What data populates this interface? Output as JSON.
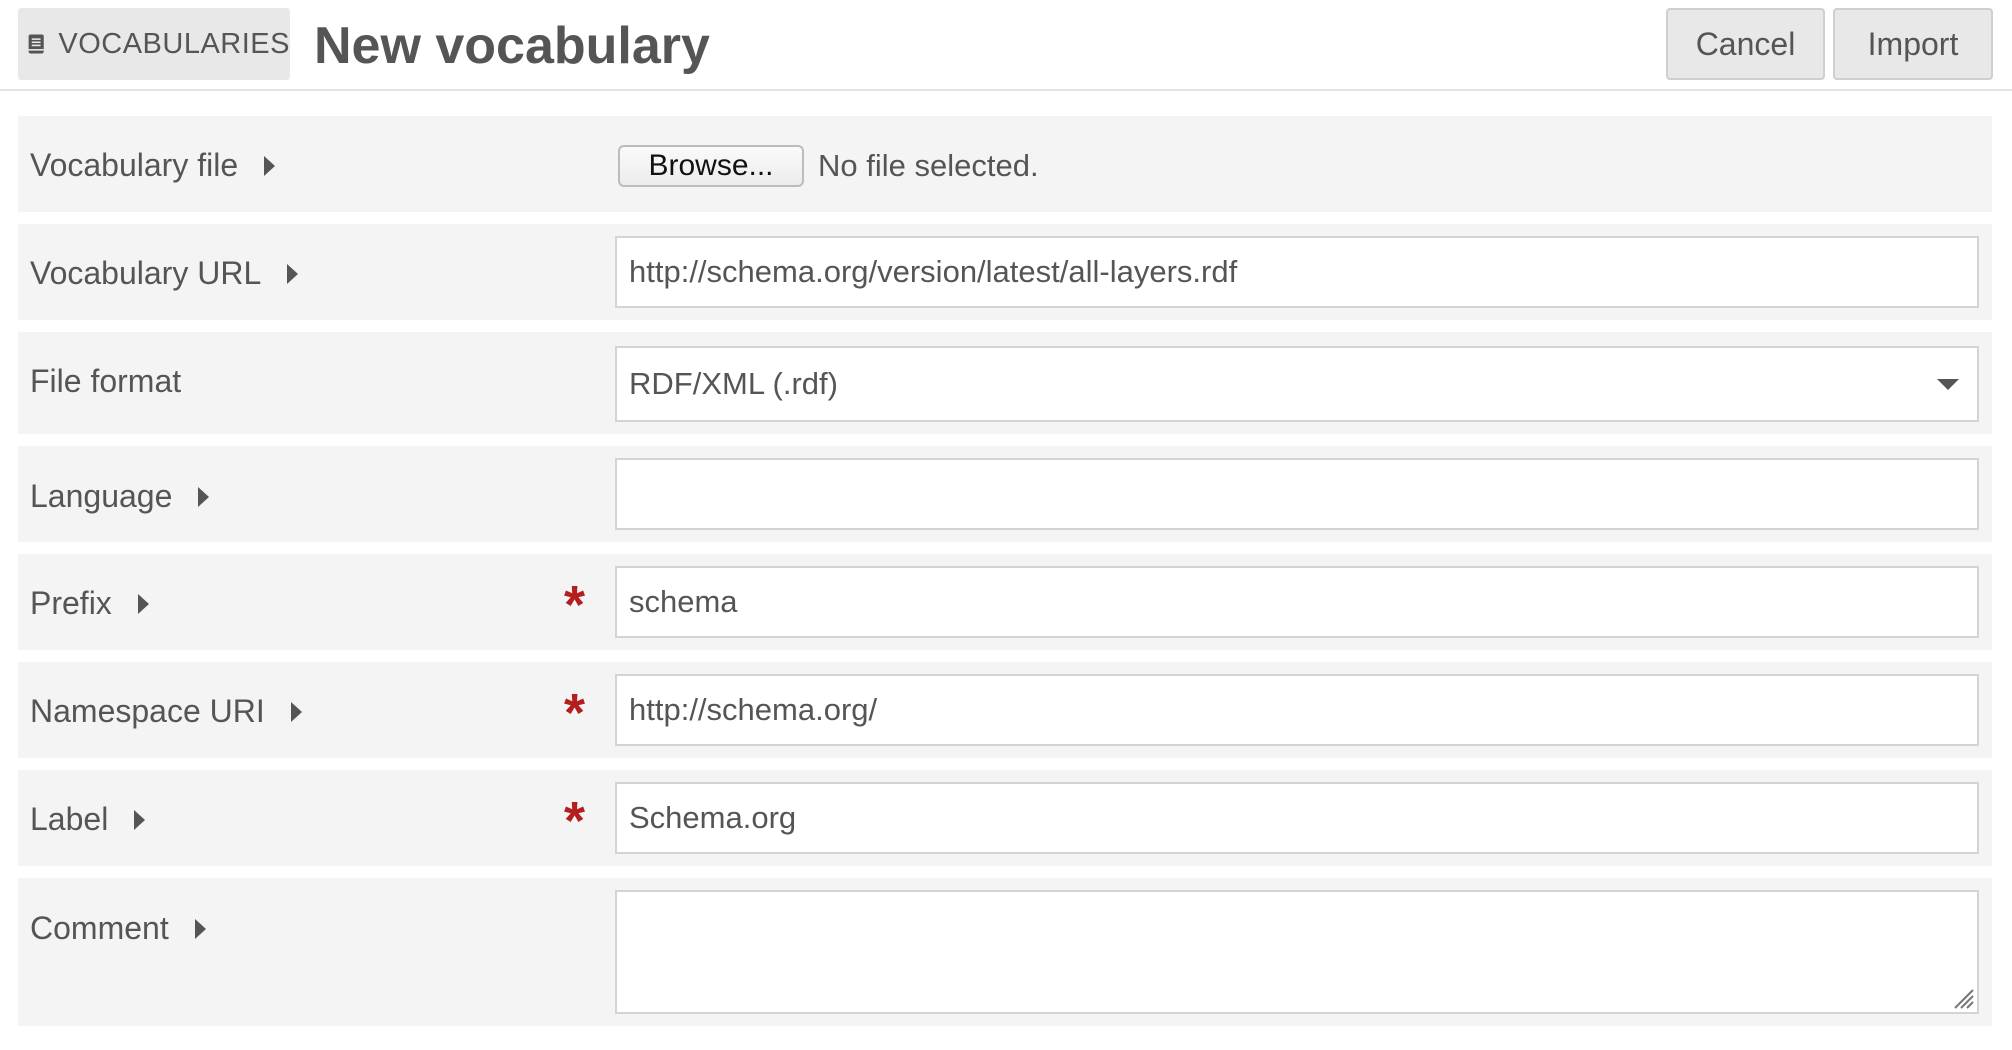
{
  "header": {
    "section_label": "VOCABULARIES",
    "title": "New vocabulary",
    "cancel_label": "Cancel",
    "import_label": "Import"
  },
  "form": {
    "vocabulary_file": {
      "label": "Vocabulary file",
      "browse_label": "Browse...",
      "status": "No file selected."
    },
    "vocabulary_url": {
      "label": "Vocabulary URL",
      "value": "http://schema.org/version/latest/all-layers.rdf"
    },
    "file_format": {
      "label": "File format",
      "value": "RDF/XML (.rdf)"
    },
    "language": {
      "label": "Language",
      "value": ""
    },
    "prefix": {
      "label": "Prefix",
      "required": true,
      "value": "schema"
    },
    "namespace_uri": {
      "label": "Namespace URI",
      "required": true,
      "value": "http://schema.org/"
    },
    "vocab_label": {
      "label": "Label",
      "required": true,
      "value": "Schema.org"
    },
    "comment": {
      "label": "Comment",
      "value": ""
    },
    "required_marker": "*"
  },
  "colors": {
    "required": "#b51e1e",
    "row_background": "#f4f4f4",
    "button_background": "#e8e8e8",
    "text": "#555555"
  },
  "icons": {
    "section": "book-icon",
    "expand": "caret-right-icon",
    "select": "caret-down-icon"
  }
}
